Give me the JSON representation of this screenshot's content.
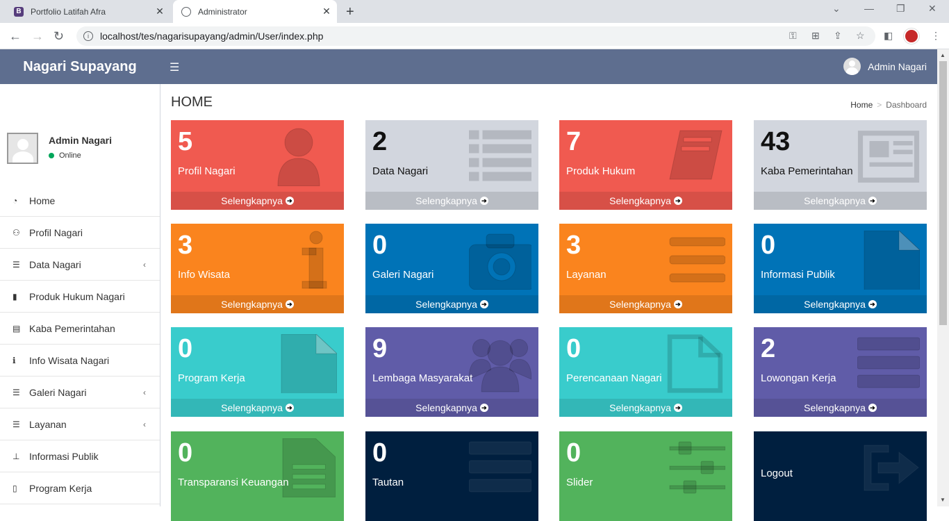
{
  "browser": {
    "tabs": [
      {
        "title": "Portfolio Latifah Afra",
        "favicon": "B"
      },
      {
        "title": "Administrator",
        "favicon": "globe-icon"
      }
    ],
    "url": "localhost/tes/nagarisupayang/admin/User/index.php"
  },
  "header": {
    "brand": "Nagari Supayang",
    "user_name": "Admin Nagari"
  },
  "sidebar": {
    "user_name": "Admin Nagari",
    "status": "Online",
    "items": [
      {
        "label": "Home",
        "icon": "dashboard-icon",
        "has_children": false
      },
      {
        "label": "Profil Nagari",
        "icon": "users-icon",
        "has_children": false
      },
      {
        "label": "Data Nagari",
        "icon": "list-icon",
        "has_children": true
      },
      {
        "label": "Produk Hukum Nagari",
        "icon": "bookmark-icon",
        "has_children": false
      },
      {
        "label": "Kaba Pemerintahan",
        "icon": "newspaper-icon",
        "has_children": false
      },
      {
        "label": "Info Wisata Nagari",
        "icon": "info-icon",
        "has_children": false
      },
      {
        "label": "Galeri Nagari",
        "icon": "list-icon",
        "has_children": true
      },
      {
        "label": "Layanan",
        "icon": "list-icon",
        "has_children": true
      },
      {
        "label": "Informasi Publik",
        "icon": "thumbtack-icon",
        "has_children": false
      },
      {
        "label": "Program Kerja",
        "icon": "file-icon",
        "has_children": false
      }
    ]
  },
  "page": {
    "title": "HOME",
    "breadcrumb": [
      "Home",
      "Dashboard"
    ]
  },
  "boxes": [
    {
      "count": "5",
      "label": "Profil Nagari",
      "footer": "Selengkapnya",
      "color": "#f05a50",
      "icon": "user-icon"
    },
    {
      "count": "2",
      "label": "Data Nagari",
      "footer": "Selengkapnya",
      "color": "#d2d6de",
      "icon": "list-icon"
    },
    {
      "count": "7",
      "label": "Produk Hukum",
      "footer": "Selengkapnya",
      "color": "#f05a50",
      "icon": "book-icon"
    },
    {
      "count": "43",
      "label": "Kaba Pemerintahan",
      "footer": "Selengkapnya",
      "color": "#d2d6de",
      "icon": "newspaper-icon"
    },
    {
      "count": "3",
      "label": "Info Wisata",
      "footer": "Selengkapnya",
      "color": "#fa841e",
      "icon": "info-icon"
    },
    {
      "count": "0",
      "label": "Galeri Nagari",
      "footer": "Selengkapnya",
      "color": "#0073b7",
      "icon": "camera-icon"
    },
    {
      "count": "3",
      "label": "Layanan",
      "footer": "Selengkapnya",
      "color": "#fa841e",
      "icon": "bars-icon"
    },
    {
      "count": "0",
      "label": "Informasi Publik",
      "footer": "Selengkapnya",
      "color": "#0073b7",
      "icon": "file-icon"
    },
    {
      "count": "0",
      "label": "Program Kerja",
      "footer": "Selengkapnya",
      "color": "#39cccc",
      "icon": "file-icon"
    },
    {
      "count": "9",
      "label": "Lembaga Masyarakat",
      "footer": "Selengkapnya",
      "color": "#605ca8",
      "icon": "group-icon"
    },
    {
      "count": "0",
      "label": "Perencanaan Nagari",
      "footer": "Selengkapnya",
      "color": "#39cccc",
      "icon": "file-outline-icon"
    },
    {
      "count": "2",
      "label": "Lowongan Kerja",
      "footer": "Selengkapnya",
      "color": "#605ca8",
      "icon": "server-icon"
    },
    {
      "count": "0",
      "label": "Transparansi Keuangan",
      "footer": "",
      "color": "#52b35c",
      "icon": "file-text-icon"
    },
    {
      "count": "0",
      "label": "Tautan",
      "footer": "",
      "color": "#001f3f",
      "icon": "server-icon"
    },
    {
      "count": "0",
      "label": "Slider",
      "footer": "",
      "color": "#52b35c",
      "icon": "sliders-icon"
    },
    {
      "count": "",
      "label": "Logout",
      "footer": "",
      "color": "#001f3f",
      "icon": "sign-out-icon"
    }
  ]
}
